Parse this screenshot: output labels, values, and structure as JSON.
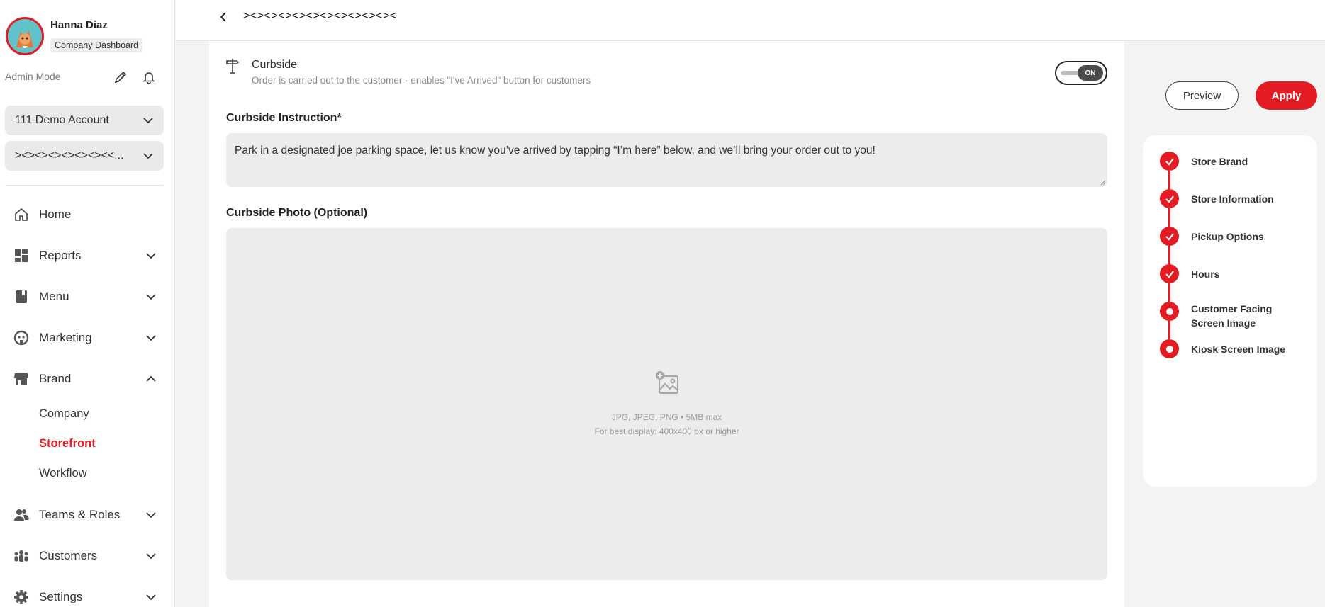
{
  "user": {
    "name": "Hanna Diaz",
    "role": "Company Dashboard",
    "mode": "Admin Mode"
  },
  "account_select": {
    "value": "111 Demo Account"
  },
  "store_select": {
    "value": "><><><><><><><<..."
  },
  "nav": {
    "items": [
      {
        "label": "Home",
        "icon": "home-icon"
      },
      {
        "label": "Reports",
        "icon": "dashboard-icon"
      },
      {
        "label": "Menu",
        "icon": "book-icon"
      },
      {
        "label": "Marketing",
        "icon": "marketing-icon"
      },
      {
        "label": "Brand",
        "icon": "store-icon"
      },
      {
        "label": "Teams & Roles",
        "icon": "people-icon"
      },
      {
        "label": "Customers",
        "icon": "group-icon"
      },
      {
        "label": "Settings",
        "icon": "gear-icon"
      }
    ],
    "brand_sub": [
      {
        "label": "Company"
      },
      {
        "label": "Storefront",
        "active": true
      },
      {
        "label": "Workflow"
      }
    ]
  },
  "header": {
    "title": "><><><><><><><><><><><"
  },
  "curbside": {
    "title": "Curbside",
    "description": "Order is carried out to the customer - enables \"I've Arrived\" button for customers",
    "toggle": "ON"
  },
  "instruction": {
    "label": "Curbside Instruction*",
    "value": "Park in a designated joe parking space, let us know you’ve arrived by tapping “I’m here” below, and we’ll bring your order out to you!"
  },
  "photo": {
    "label": "Curbside Photo (Optional)",
    "hint1": "JPG, JPEG, PNG • 5MB max",
    "hint2": "For best display: 400x400 px or higher"
  },
  "actions": {
    "preview": "Preview",
    "apply": "Apply"
  },
  "steps": [
    {
      "label": "Store Brand",
      "done": true
    },
    {
      "label": "Store Information",
      "done": true
    },
    {
      "label": "Pickup Options",
      "done": true
    },
    {
      "label": "Hours",
      "done": true
    },
    {
      "label": "Customer Facing Screen Image",
      "done": false
    },
    {
      "label": "Kiosk Screen Image",
      "done": false
    }
  ],
  "colors": {
    "accent": "#e31b23",
    "surface": "#ececec",
    "background": "#f3f3f3"
  }
}
